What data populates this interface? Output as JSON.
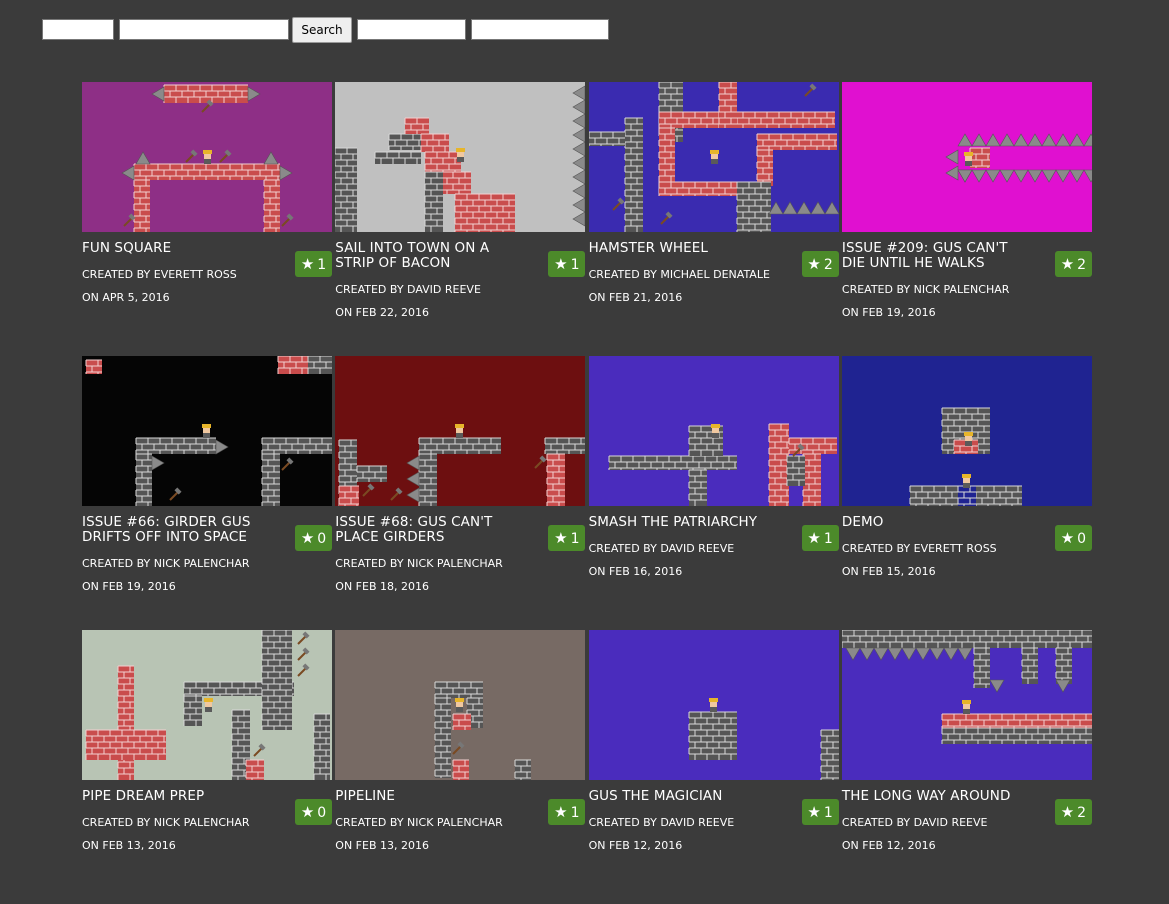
{
  "search": {
    "field1_value": "",
    "field2_value": "",
    "button_label": "Search",
    "field3_value": "",
    "field4_value": ""
  },
  "colors": {
    "page_bg": "#3b3b3b",
    "badge_bg": "#4c8a2a",
    "brick_red": "#c94c4c",
    "brick_gray": "#555555"
  },
  "levels": [
    {
      "title": "FUN SQUARE",
      "creator": "CREATED BY EVERETT ROSS",
      "date": "ON APR 5, 2016",
      "stars": "1",
      "bg": "#8e2f86",
      "icon": "level-thumbnail-icon"
    },
    {
      "title": "SAIL INTO TOWN ON A STRIP OF BACON",
      "creator": "CREATED BY DAVID REEVE",
      "date": "ON FEB 22, 2016",
      "stars": "1",
      "bg": "#c0c0c0",
      "icon": "level-thumbnail-icon"
    },
    {
      "title": "HAMSTER WHEEL",
      "creator": "CREATED BY MICHAEL DENATALE",
      "date": "ON FEB 21, 2016",
      "stars": "2",
      "bg": "#3a2bb0",
      "icon": "level-thumbnail-icon"
    },
    {
      "title": "ISSUE #209: GUS CAN'T DIE UNTIL HE WALKS",
      "creator": "CREATED BY NICK PALENCHAR",
      "date": "ON FEB 19, 2016",
      "stars": "2",
      "bg": "#e010d0",
      "icon": "level-thumbnail-icon"
    },
    {
      "title": "ISSUE #66: GIRDER GUS DRIFTS OFF INTO SPACE",
      "creator": "CREATED BY NICK PALENCHAR",
      "date": "ON FEB 19, 2016",
      "stars": "0",
      "bg": "#050505",
      "icon": "level-thumbnail-icon"
    },
    {
      "title": "ISSUE #68: GUS CAN'T PLACE GIRDERS",
      "creator": "CREATED BY NICK PALENCHAR",
      "date": "ON FEB 18, 2016",
      "stars": "1",
      "bg": "#6d0f10",
      "icon": "level-thumbnail-icon"
    },
    {
      "title": "SMASH THE PATRIARCHY",
      "creator": "CREATED BY DAVID REEVE",
      "date": "ON FEB 16, 2016",
      "stars": "1",
      "bg": "#4a2cbd",
      "icon": "level-thumbnail-icon"
    },
    {
      "title": "DEMO",
      "creator": "CREATED BY EVERETT ROSS",
      "date": "ON FEB 15, 2016",
      "stars": "0",
      "bg": "#1f2391",
      "icon": "level-thumbnail-icon"
    },
    {
      "title": "PIPE DREAM PREP",
      "creator": "CREATED BY NICK PALENCHAR",
      "date": "ON FEB 13, 2016",
      "stars": "0",
      "bg": "#b8c4b4",
      "icon": "level-thumbnail-icon"
    },
    {
      "title": "PIPELINE",
      "creator": "CREATED BY NICK PALENCHAR",
      "date": "ON FEB 13, 2016",
      "stars": "1",
      "bg": "#776a64",
      "icon": "level-thumbnail-icon"
    },
    {
      "title": "GUS THE MAGICIAN",
      "creator": "CREATED BY DAVID REEVE",
      "date": "ON FEB 12, 2016",
      "stars": "1",
      "bg": "#4a2cbd",
      "icon": "level-thumbnail-icon"
    },
    {
      "title": "THE LONG WAY AROUND",
      "creator": "CREATED BY DAVID REEVE",
      "date": "ON FEB 12, 2016",
      "stars": "2",
      "bg": "#4a2cbd",
      "icon": "level-thumbnail-icon"
    }
  ]
}
